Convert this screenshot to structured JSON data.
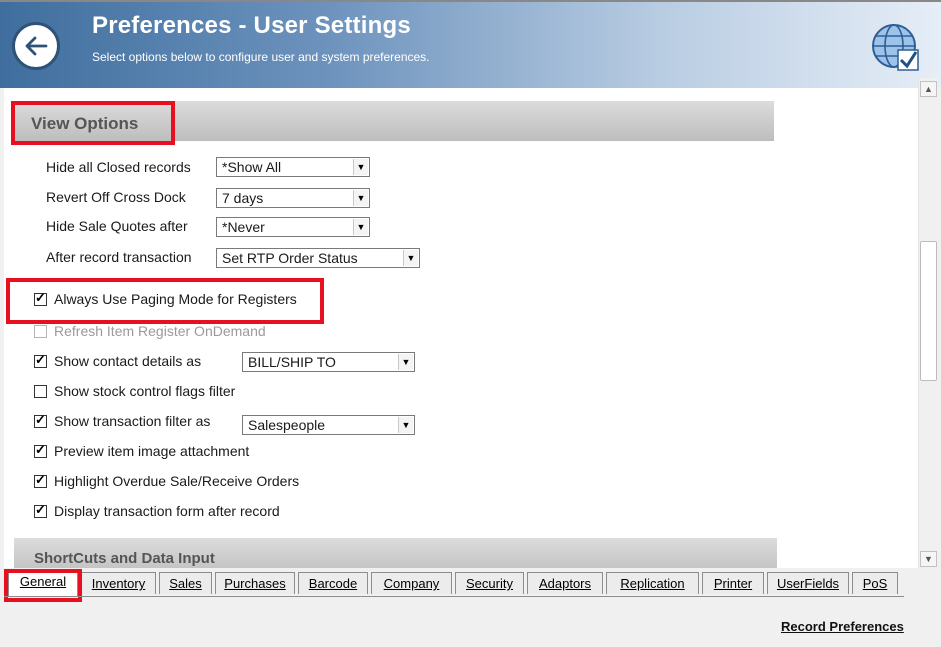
{
  "header": {
    "title": "Preferences - User Settings",
    "subtitle": "Select options below to configure user and system preferences."
  },
  "sections": {
    "view_options": "View Options",
    "shortcuts": "ShortCuts and Data Input"
  },
  "dropdown_fields": [
    {
      "label": "Hide all Closed records",
      "value": "*Show All"
    },
    {
      "label": "Revert Off Cross Dock",
      "value": "7 days"
    },
    {
      "label": "Hide Sale Quotes after",
      "value": "*Never"
    },
    {
      "label": "After record transaction",
      "value": "Set RTP Order Status"
    }
  ],
  "checkboxes": [
    {
      "label": "Always Use Paging Mode for Registers",
      "checked": true,
      "enabled": true
    },
    {
      "label": "Refresh Item Register OnDemand",
      "checked": false,
      "enabled": false
    },
    {
      "label": "Show contact details as",
      "checked": true,
      "enabled": true,
      "select_value": "BILL/SHIP TO"
    },
    {
      "label": "Show stock control flags filter",
      "checked": false,
      "enabled": true
    },
    {
      "label": "Show transaction filter as",
      "checked": true,
      "enabled": true,
      "select_value": "Salespeople"
    },
    {
      "label": "Preview item image attachment",
      "checked": true,
      "enabled": true
    },
    {
      "label": "Highlight Overdue Sale/Receive Orders",
      "checked": true,
      "enabled": true
    },
    {
      "label": "Display transaction form after record",
      "checked": true,
      "enabled": true
    }
  ],
  "tabs": [
    "General",
    "Inventory",
    "Sales",
    "Purchases",
    "Barcode",
    "Company",
    "Security",
    "Adaptors",
    "Replication",
    "Printer",
    "UserFields",
    "PoS"
  ],
  "active_tab": "General",
  "footer": {
    "record_label": "Record Preferences"
  },
  "colors": {
    "highlight": "#e8101e",
    "header_dark": "#3f6e9e"
  }
}
